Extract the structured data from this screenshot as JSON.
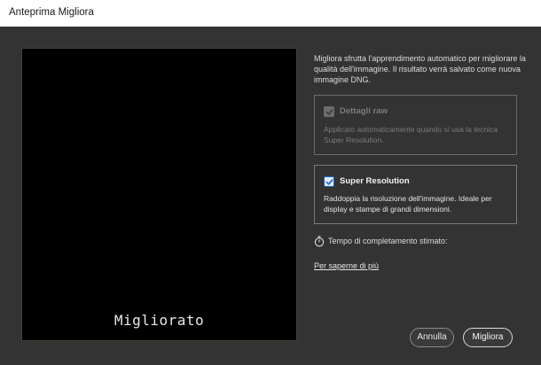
{
  "window": {
    "title": "Anteprima Migliora"
  },
  "preview": {
    "caption": "Migliorato"
  },
  "description": "Migliora sfrutta l'apprendimento automatico per migliorare la qualità dell'immagine. Il risultato verrà salvato come nuova immagine DNG.",
  "options": {
    "raw_details": {
      "label": "Dettagli raw",
      "checked": true,
      "enabled": false,
      "description": "Applicato automaticamente quando si usa la tecnica Super Resolution."
    },
    "super_resolution": {
      "label": "Super Resolution",
      "checked": true,
      "enabled": true,
      "description": "Raddoppia la risoluzione dell'immagine. Ideale per display e stampe di grandi dimensioni."
    }
  },
  "estimate": {
    "label": "Tempo di completamento stimato:",
    "icon": "stopwatch-icon"
  },
  "learn_more": "Per saperne di più",
  "buttons": {
    "cancel": "Annulla",
    "enhance": "Migliora"
  },
  "colors": {
    "background": "#333333",
    "check_accent": "#1e64c8",
    "disabled_text": "#7a7a7a"
  }
}
